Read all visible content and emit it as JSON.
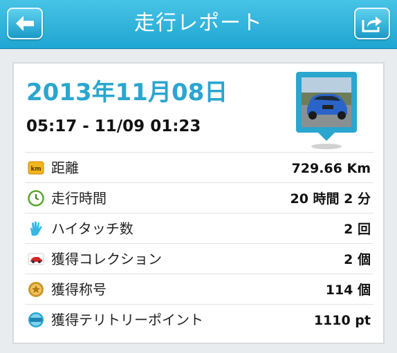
{
  "header": {
    "title": "走行レポート",
    "back_icon": "arrow-left-icon",
    "share_icon": "share-icon",
    "accent": "#2aa6cf"
  },
  "report": {
    "date": "2013年11月08日",
    "time_range": "05:17 - 11/09 01:23",
    "car_image": "blue-car-photo"
  },
  "stats": [
    {
      "icon": "km-icon",
      "label": "距離",
      "value": "729.66 Km"
    },
    {
      "icon": "clock-icon",
      "label": "走行時間",
      "value": "20 時間 2 分"
    },
    {
      "icon": "hand-icon",
      "label": "ハイタッチ数",
      "value": "2 回"
    },
    {
      "icon": "car-icon",
      "label": "獲得コレクション",
      "value": "2 個"
    },
    {
      "icon": "medal-icon",
      "label": "獲得称号",
      "value": "114 個"
    },
    {
      "icon": "spot-icon",
      "label": "獲得テリトリーポイント",
      "value": "1110 pt"
    }
  ]
}
